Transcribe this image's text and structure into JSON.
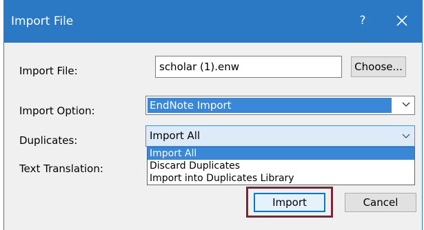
{
  "window": {
    "title": "Import File",
    "help_label": "?",
    "close_icon": "close-icon"
  },
  "form": {
    "import_file_label": "Import File:",
    "import_file_value": "scholar (1).enw",
    "choose_button": "Choose...",
    "import_option_label": "Import Option:",
    "import_option_value": "EndNote Import",
    "duplicates_label": "Duplicates:",
    "duplicates_value": "Import All",
    "text_translation_label": "Text Translation:"
  },
  "duplicates_dropdown": {
    "options": [
      "Import All",
      "Discard Duplicates",
      "Import into Duplicates Library"
    ],
    "selected_index": 0
  },
  "buttons": {
    "import": "Import",
    "cancel": "Cancel"
  },
  "colors": {
    "titlebar": "#2b78c5",
    "selection": "#3a87d8",
    "highlight_box": "#7a2436"
  }
}
